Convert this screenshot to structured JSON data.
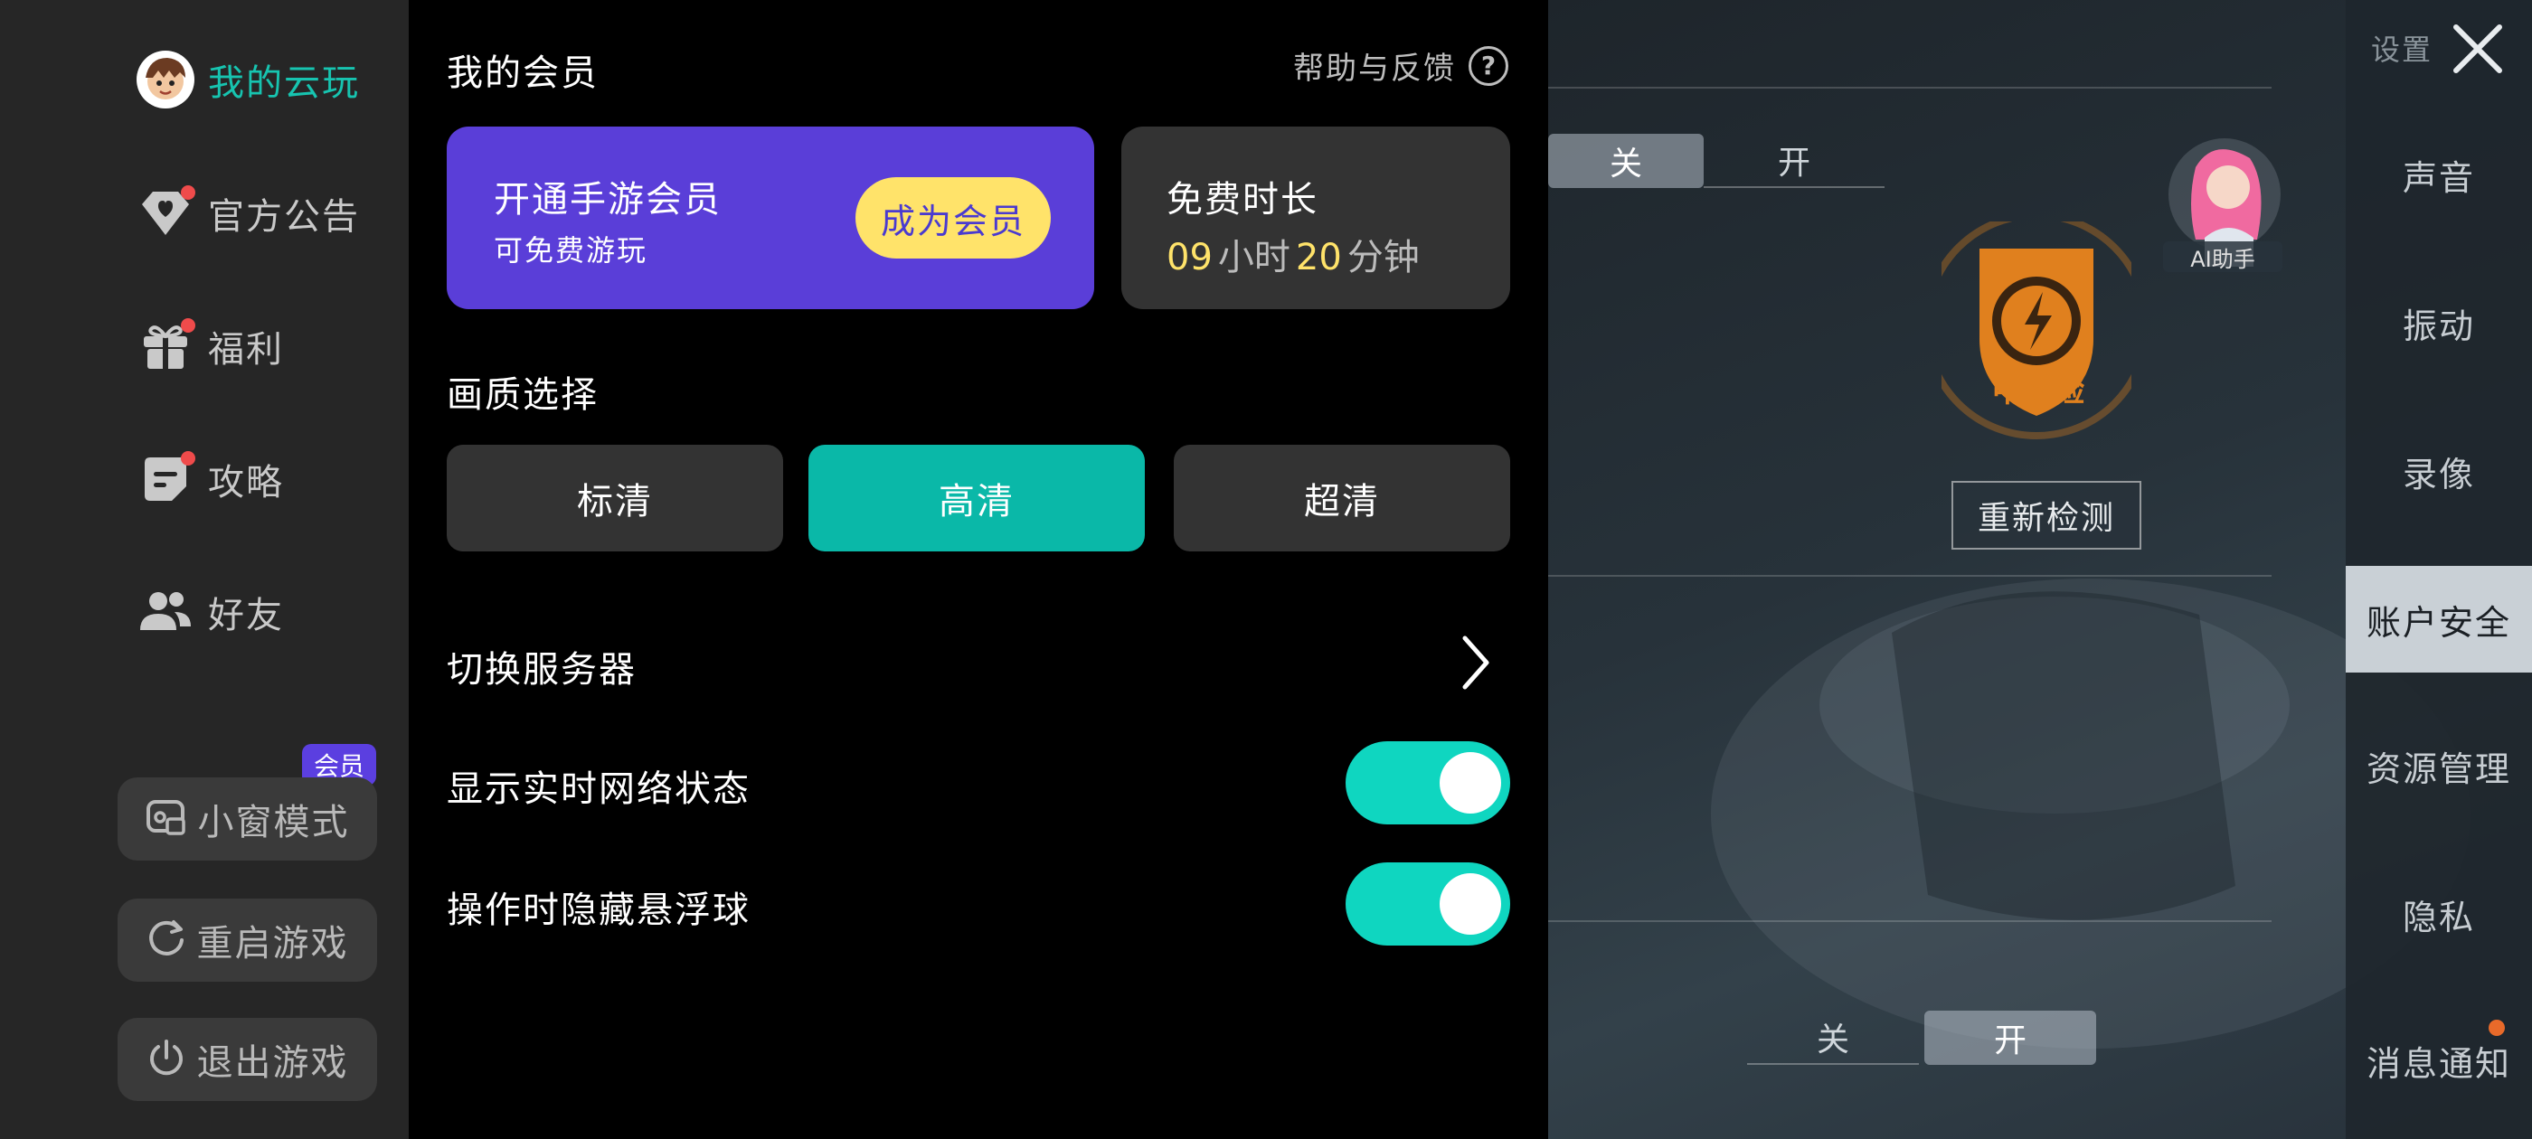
{
  "nav": {
    "my_cloud": "我的云玩",
    "items": [
      {
        "label": "官方公告",
        "icon": "diamond-heart-icon",
        "dot": true
      },
      {
        "label": "福利",
        "icon": "gift-icon",
        "dot": true
      },
      {
        "label": "攻略",
        "icon": "guide-note-icon",
        "dot": true
      },
      {
        "label": "好友",
        "icon": "friends-icon",
        "dot": false
      }
    ],
    "vip_badge": "会员",
    "buttons": {
      "small_window": "小窗模式",
      "restart": "重启游戏",
      "exit": "退出游戏"
    }
  },
  "panel": {
    "title": "我的会员",
    "help": "帮助与反馈",
    "vip_card": {
      "title": "开通手游会员",
      "subtitle": "可免费游玩",
      "button": "成为会员"
    },
    "free_time": {
      "title": "免费时长",
      "hours": "09",
      "hours_unit": "小时",
      "minutes": "20",
      "minutes_unit": "分钟"
    },
    "quality": {
      "title": "画质选择",
      "options": [
        "标清",
        "高清",
        "超清"
      ],
      "selected": "高清"
    },
    "switch_server": "切换服务器",
    "show_network": {
      "label": "显示实时网络状态",
      "on": true
    },
    "hide_float": {
      "label": "操作时隐藏悬浮球",
      "on": true
    }
  },
  "game": {
    "toggle_top": {
      "off": "关",
      "on": "开",
      "selected": "关"
    },
    "toggle_bottom": {
      "off": "关",
      "on": "开",
      "selected": "开"
    },
    "risk": "中风险",
    "recheck": "重新检测",
    "ai_helper": "AI助手",
    "settings_tag": "设置",
    "settings_items": [
      "声音",
      "振动",
      "录像",
      "账户安全",
      "资源管理",
      "隐私",
      "消息通知"
    ],
    "settings_active": "账户安全",
    "colors": {
      "risk_orange": "#e0801e"
    }
  },
  "colors": {
    "accent": "#17c4b0",
    "vip_purple": "#5a3ed8",
    "vip_yellow": "#ffe36a",
    "toggle_on": "#0fd6c0"
  }
}
